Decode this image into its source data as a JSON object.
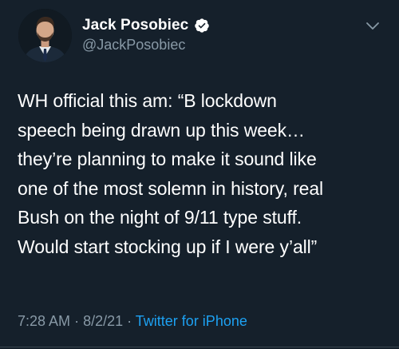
{
  "author": {
    "display_name": "Jack Posobiec",
    "handle": "@JackPosobiec",
    "verified": true,
    "avatar_icon": "profile-photo"
  },
  "tweet": {
    "lines": [
      "WH official this am: “B lockdown",
      "speech being drawn up this week…",
      "they’re planning to make it sound like",
      "one of the most solemn in history, real",
      "Bush on the night of 9/11 type stuff.",
      "Would start stocking up if I were y’all”"
    ]
  },
  "meta": {
    "time": "7:28 AM",
    "date": "8/2/21",
    "separator": "·",
    "source": "Twitter for iPhone"
  },
  "colors": {
    "background": "#15202b",
    "text": "#ffffff",
    "secondary": "#8899a6",
    "link": "#1da1f2",
    "divider": "#38444d"
  }
}
